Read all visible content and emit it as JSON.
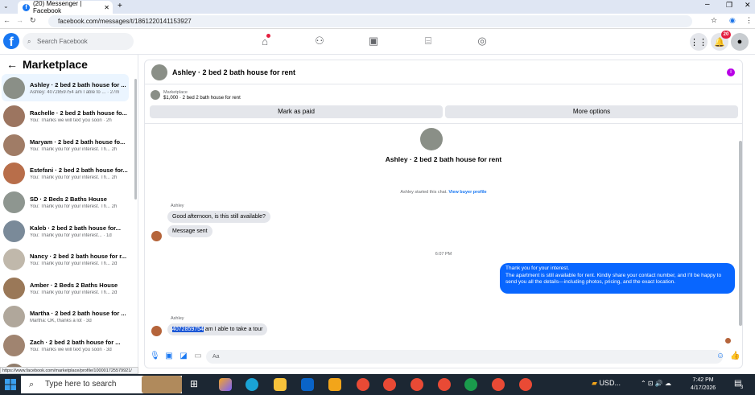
{
  "browser": {
    "tab_title": "(20) Messenger | Facebook",
    "url": "facebook.com/messages/t/1861220141153927",
    "new_tab_symbol": "+",
    "status_link": "https://www.facebook.com/marketplace/profile/100001725579921/"
  },
  "header": {
    "search_placeholder": "Search Facebook",
    "notification_count": "20"
  },
  "sidebar": {
    "title": "Marketplace",
    "conversations": [
      {
        "name": "Ashley · 2 bed 2 bath house for ...",
        "preview": "Ashley: 4072859754 am I able to ... · 27m",
        "active": true,
        "thumb": "#8a8f87"
      },
      {
        "name": "Rachelle · 2 bed 2 bath house fo...",
        "preview": "You: Thanks we will text you soon · 2h",
        "active": false,
        "thumb": "#9c7560"
      },
      {
        "name": "Maryam · 2 bed 2 bath house fo...",
        "preview": "You: Thank you for your interest. Th... 2h",
        "active": false,
        "thumb": "#a07c66"
      },
      {
        "name": "Estefani · 2 bed 2 bath house for...",
        "preview": "You: Thank you for your interest. Th... 2h",
        "active": false,
        "thumb": "#b86e4a"
      },
      {
        "name": "SD · 2 Beds 2 Baths House",
        "preview": "You: Thank you for your interest. Th... 2h",
        "active": false,
        "thumb": "#8e9690"
      },
      {
        "name": "Kaleb · 2 bed 2 bath house for...",
        "preview": "You: Thank you for your interest... · 1d",
        "active": false,
        "thumb": "#7a8a99"
      },
      {
        "name": "Nancy · 2 bed 2 bath house for r...",
        "preview": "You: Thank you for your interest. Th... 2d",
        "active": false,
        "thumb": "#c0b8ab"
      },
      {
        "name": "Amber · 2 Beds 2 Baths House",
        "preview": "You: Thank you for your interest. Th... 2d",
        "active": false,
        "thumb": "#9a7858"
      },
      {
        "name": "Martha · 2 bed 2 bath house for ...",
        "preview": "Martha: OK, thanks a lot · 3d",
        "active": false,
        "thumb": "#b0a79b"
      },
      {
        "name": "Zach · 2 bed 2 bath house for ...",
        "preview": "You: Thanks we will text you soon · 3d",
        "active": false,
        "thumb": "#a08470"
      },
      {
        "name": "Gynrav · 2 bed 2 bath house f...",
        "preview": "",
        "active": false,
        "thumb": "#907d6c"
      }
    ]
  },
  "chat": {
    "title": "Ashley · 2 bed 2 bath house for rent",
    "marketplace_label": "Marketplace",
    "listing_line": "$1,000 · 2 bed 2 bath house for rent",
    "mark_paid": "Mark as paid",
    "more_options": "More options",
    "center_title": "Ashley · 2 bed 2 bath house for rent",
    "started_text": "Ashley started this chat.",
    "view_profile": "View buyer profile",
    "sender1": "Ashley",
    "msg1": "Good afternoon, is this still available?",
    "msg2": "Message sent",
    "time": "6:07 PM",
    "out_line1": "Thank you for your interest.",
    "out_line2": "The apartment is still available for rent. Kindly share your contact number, and I’ll be happy to send you all the details—including photos, pricing, and the exact location.",
    "sender2": "Ashley",
    "phone": "4072859754",
    "msg3_rest": " am I able to take a tour",
    "input_placeholder": "Aa"
  },
  "taskbar": {
    "search_text": "Type here to search",
    "weather": "USD...",
    "time": "7:42 PM",
    "date": "4/17/2026",
    "notif": "3"
  }
}
